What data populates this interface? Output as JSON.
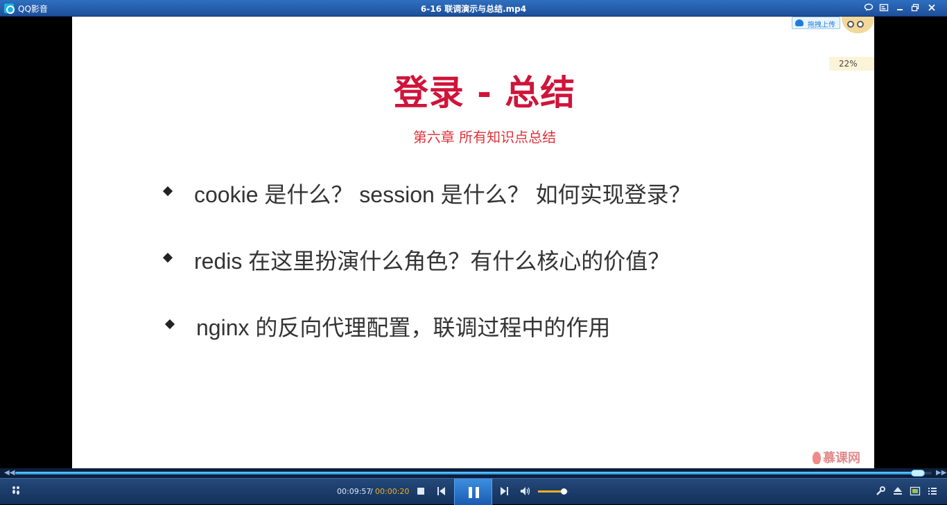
{
  "window": {
    "app_name": "QQ影音",
    "file_title": "6-16 联调演示与总结.mp4"
  },
  "slide": {
    "title": "登录 - 总结",
    "subtitle": "第六章  所有知识点总结",
    "bullets": [
      "cookie 是什么？ session 是什么？ 如何实现登录？",
      "redis 在这里扮演什么角色？有什么核心的价值？",
      "nginx 的反向代理配置，联调过程中的作用"
    ]
  },
  "overlay": {
    "upload_label": "拖拽上传",
    "percent": "22%",
    "watermark": "慕课网"
  },
  "player": {
    "elapsed": "00:09:57",
    "separator": "/",
    "total": "00:00:20",
    "seek_progress": 0.985,
    "volume": 0.85,
    "state": "playing"
  },
  "icons": {
    "footprint": "footprint-icon",
    "stop": "stop-icon",
    "prev": "previous-icon",
    "pause": "pause-icon",
    "next": "next-icon",
    "volume": "volume-icon",
    "settings": "wrench-icon",
    "eject": "eject-icon",
    "screen": "screen-mode-icon",
    "playlist": "playlist-icon"
  },
  "colors": {
    "title_red": "#d0143a",
    "subtitle_red": "#e0323a",
    "accent_blue": "#1f86d8",
    "time_orange": "#f0b020"
  }
}
